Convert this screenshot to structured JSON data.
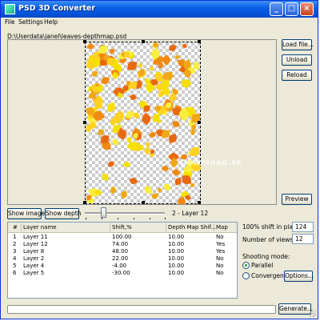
{
  "window": {
    "title": "PSD 3D Converter",
    "icon": "app-icon",
    "controls": {
      "minimize": "_",
      "maximize": "□",
      "close": "×"
    }
  },
  "menu": {
    "items": [
      "File",
      "Settings",
      "Help"
    ]
  },
  "file_path": "D:\\Userdata\\janel\\leaves-depthmap.psd",
  "buttons": {
    "load_file": "Load file...",
    "unload": "Unload",
    "reload": "Reload",
    "preview": "Preview",
    "show_image": "Show image",
    "show_depth": "Show depth",
    "options": "Options...",
    "generate": "Generate..."
  },
  "layer_slider": {
    "label": "2 - Layer 12"
  },
  "watermark": "Download.sk",
  "table": {
    "columns": [
      "#",
      "Layer name",
      "Shift,%",
      "Depth Map Shif...",
      "Map"
    ],
    "rows": [
      [
        "1",
        "Layer 11",
        "100.00",
        "10.00",
        "No"
      ],
      [
        "2",
        "Layer 12",
        "74.00",
        "10.00",
        "Yes"
      ],
      [
        "3",
        "Layer 8",
        "48.00",
        "10.00",
        "Yes"
      ],
      [
        "4",
        "Layer 2",
        "22.00",
        "10.00",
        "No"
      ],
      [
        "5",
        "Layer 4",
        "-4.00",
        "10.00",
        "No"
      ],
      [
        "6",
        "Layer 5",
        "-30.00",
        "10.00",
        "No"
      ]
    ]
  },
  "settings": {
    "shift_label": "100% shift in pixels:",
    "shift_value": "124",
    "views_label": "Number of views:",
    "views_value": "12",
    "mode_label": "Shooting mode:",
    "mode_parallel": "Parallel",
    "mode_convergence": "Convergence",
    "selected_mode": "Parallel"
  },
  "colors": {
    "titlebar": "#0a5fe8",
    "leaf_yellow": "#f5e000",
    "leaf_orange": "#f08a10"
  }
}
